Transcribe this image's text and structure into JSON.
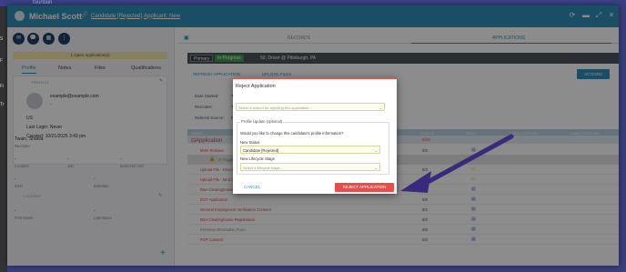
{
  "background": {
    "brand": "fountain",
    "sidebar_labels": [
      "S",
      "F",
      "Fi",
      "Tr"
    ]
  },
  "window": {
    "candidate_name": "Michael Scott",
    "candidate_status": "Candidate [Rejected]",
    "applicant_status": "Applicant: New"
  },
  "left": {
    "open_apps": "1 Open Application(s)",
    "tabs": [
      "Profile",
      "Notes",
      "Files",
      "Qualifications"
    ],
    "profile_label": "PROFILE",
    "email": "example@example.com",
    "email_dash": "-",
    "country": "US",
    "last_login": "Last Login: Never",
    "created": "Created: 10/21/2025 3:49 pm",
    "recruiter_name": "Twain, Shania",
    "recruiter_label": "Recruiter",
    "fields_row1": [
      {
        "value": "-",
        "label": "Location"
      },
      {
        "value": "-",
        "label": "Job"
      },
      {
        "value": "-",
        "label": "Business Unit"
      }
    ],
    "fields_row2": [
      {
        "value": "-",
        "label": "SSN"
      },
      {
        "value": "-",
        "label": "Birthdate"
      }
    ],
    "license_label": "LICENSE",
    "fields_row3": [
      {
        "value": "-",
        "label": "First Name"
      },
      {
        "value": "-",
        "label": "Last Name"
      }
    ]
  },
  "right": {
    "tab_records": "RECORDS",
    "tab_applications": "APPLICATIONS",
    "pill_primary": "Primary",
    "pill_progress": "In Progress",
    "app_title": "50, Driver @ Pittsburgh, PA",
    "refresh": "REFRESH APPLICATION",
    "upload": "UPLOAD FILES",
    "actions": "ACTIONS",
    "info": [
      {
        "label": "Date Started:",
        "value": "Tue"
      },
      {
        "label": "Recruiter:",
        "value": "Twa"
      },
      {
        "label": "Referral Source:",
        "value": "Dire"
      }
    ],
    "columns": [
      "TASKS",
      "STATUS",
      "RESP",
      "COMPLETED BY",
      "COMPLETED ON"
    ],
    "app_row_label": "Application",
    "app_row_status": "0/10",
    "trigger": "Trigger",
    "tasks": [
      {
        "name": "MVR Release",
        "status": "0/3"
      },
      {
        "name": "Upload File - Drivers Li",
        "status": "0/4"
      },
      {
        "name": "Upload File - Med Certi",
        "status": "0/4"
      },
      {
        "name": "D&A Clearinghouse Limited Consent",
        "status": "0/3"
      },
      {
        "name": "DOT Application",
        "status": "0/8"
      },
      {
        "name": "General Employment Verification Consent",
        "status": "0/3"
      },
      {
        "name": "D&A Clearinghouse Registration",
        "status": "0/3"
      },
      {
        "name": "Personal Information Form",
        "status": "0/6"
      },
      {
        "name": "PSP Consent",
        "status": "0/3"
      }
    ]
  },
  "modal": {
    "title": "Reject Application",
    "reason_placeholder": "Select a reason for rejecting this application...",
    "legend": "Profile Update (optional)",
    "question": "Would you like to change this candidate's profile information?",
    "new_status_label": "New Status",
    "new_status_value": "Candidate [Rejected]",
    "lifecycle_label": "New Lifecycle Stage",
    "lifecycle_placeholder": "Select a lifecycle stage...",
    "cancel": "CANCEL",
    "reject": "REJECT APPLICATION"
  },
  "colors": {
    "title_bar": "#2f8fb8",
    "reject": "#ea4c4c",
    "arrow": "#3a2a7c"
  }
}
